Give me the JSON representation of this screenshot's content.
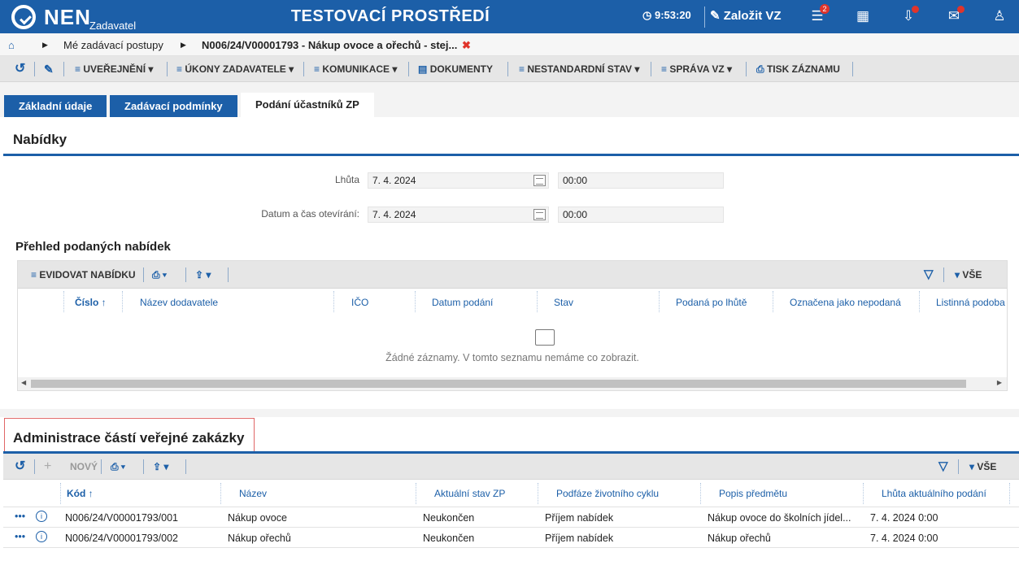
{
  "header": {
    "brand": "NEN",
    "brand_sub": "Zadavatel",
    "environment": "TESTOVACÍ PROSTŘEDÍ",
    "clock": "9:53:20",
    "create": "Založit VZ",
    "menu_badge": "2"
  },
  "breadcrumb": {
    "item1": "Mé zadávací postupy",
    "item2": "N006/24/V00001793 - Nákup ovoce a ořechů - stej..."
  },
  "toolbar": {
    "publish": "UVEŘEJNĚNÍ",
    "acts": "ÚKONY ZADAVATELE",
    "comm": "KOMUNIKACE",
    "docs": "DOKUMENTY",
    "nonstd": "NESTANDARDNÍ STAV",
    "admin": "SPRÁVA VZ",
    "print": "TISK ZÁZNAMU"
  },
  "tabs": {
    "t1": "Základní údaje",
    "t2": "Zadávací podmínky",
    "t3": "Podání účastníků ZP"
  },
  "offers": {
    "title": "Nabídky",
    "deadline_label": "Lhůta",
    "deadline_date": "7. 4. 2024",
    "deadline_time": "00:00",
    "opening_label": "Datum a čas otevírání:",
    "opening_date": "7. 4. 2024",
    "opening_time": "00:00",
    "overview_title": "Přehled podaných nabídek",
    "record_btn": "EVIDOVAT NABÍDKU",
    "all_label": "VŠE",
    "columns": [
      "Číslo ↑",
      "Název dodavatele",
      "IČO",
      "Datum podání",
      "Stav",
      "Podaná po lhůtě",
      "Označena jako nepodaná",
      "Listinná podoba"
    ],
    "empty": "Žádné záznamy. V tomto seznamu nemáme co zobrazit."
  },
  "parts": {
    "title": "Administrace částí veřejné zakázky",
    "new_btn": "NOVÝ",
    "all_label": "VŠE",
    "columns": [
      "Kód ↑",
      "Název",
      "Aktuální stav ZP",
      "Podfáze životního cyklu",
      "Popis předmětu",
      "Lhůta aktuálního podání"
    ],
    "rows": [
      [
        "N006/24/V00001793/001",
        "Nákup ovoce",
        "Neukončen",
        "Příjem nabídek",
        "Nákup ovoce do školních jídel...",
        "7. 4. 2024 0:00"
      ],
      [
        "N006/24/V00001793/002",
        "Nákup ořechů",
        "Neukončen",
        "Příjem nabídek",
        "Nákup ořechů",
        "7. 4. 2024 0:00"
      ]
    ]
  }
}
